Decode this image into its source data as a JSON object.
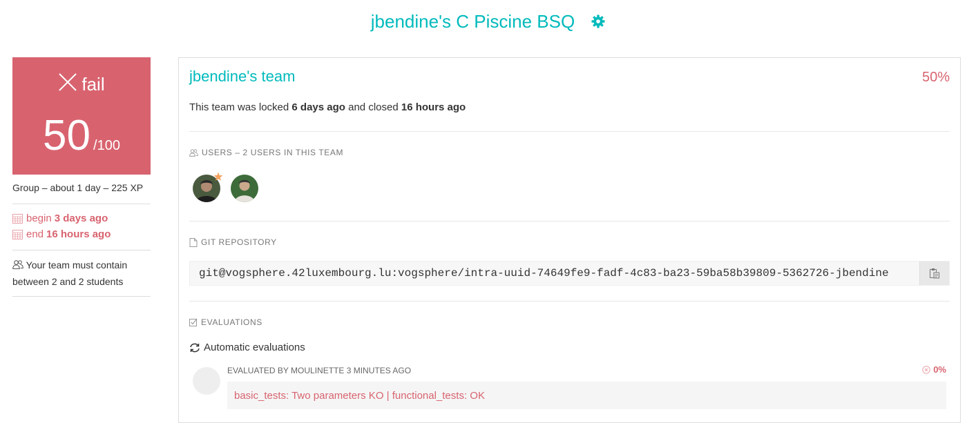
{
  "header": {
    "title": "jbendine's C Piscine BSQ"
  },
  "score": {
    "status": "fail",
    "value": "50",
    "max": "/100"
  },
  "project_meta": {
    "text": "Group – about 1 day – 225 XP"
  },
  "dates": {
    "begin_label": "begin",
    "begin_value": "3 days ago",
    "end_label": "end",
    "end_value": "16 hours ago"
  },
  "team_rule": {
    "text": "Your team must contain between 2 and 2 students"
  },
  "team": {
    "name": "jbendine's team",
    "percent": "50%",
    "lock_prefix": "This team was locked",
    "locked_when": "6 days ago",
    "lock_middle": "and closed",
    "closed_when": "16 hours ago"
  },
  "users": {
    "section_title": "USERS – 2 USERS IN THIS TEAM"
  },
  "git": {
    "section_title": "GIT REPOSITORY",
    "url": "git@vogsphere.42luxembourg.lu:vogsphere/intra-uuid-74649fe9-fadf-4c83-ba23-59ba58b39809-5362726-jbendine"
  },
  "evaluations": {
    "section_title": "EVALUATIONS",
    "auto_label": "Automatic evaluations",
    "items": [
      {
        "evaluated_by": "EVALUATED BY MOULINETTE 3 MINUTES AGO",
        "percent": "0%",
        "result": "basic_tests: Two parameters KO | functional_tests: OK"
      }
    ]
  },
  "colors": {
    "accent": "#00babc",
    "fail": "#d8636f"
  }
}
